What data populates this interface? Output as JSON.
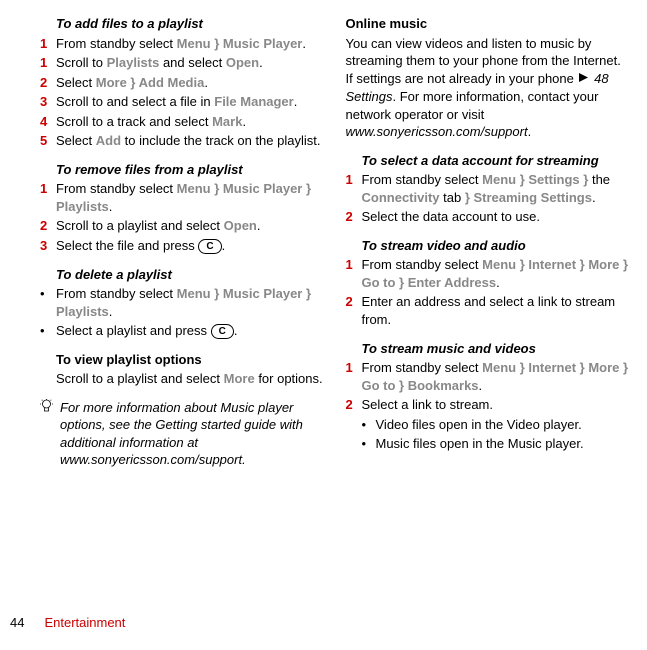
{
  "left": {
    "h1": "To add files to a playlist",
    "s1a": "From standby select ",
    "s1b": "Menu } Music Player",
    "s1c": ".",
    "s2a": "Scroll to ",
    "s2b": "Playlists",
    "s2c": " and select ",
    "s2d": "Open",
    "s2e": ".",
    "s3a": "Select ",
    "s3b": "More } Add Media",
    "s3c": ".",
    "s4a": "Scroll to and select a file in ",
    "s4b": "File Manager",
    "s4c": ".",
    "s5a": "Scroll to a track and select ",
    "s5b": "Mark",
    "s5c": ".",
    "s6a": "Select ",
    "s6b": "Add",
    "s6c": " to include the track on the playlist.",
    "h2": "To remove files from a playlist",
    "r1a": "From standby select ",
    "r1b": "Menu } Music Player } Playlists",
    "r1c": ".",
    "r2a": "Scroll to a playlist and select ",
    "r2b": "Open",
    "r2c": ".",
    "r3a": "Select the file and press ",
    "r3c": ".",
    "h3": "To delete a playlist",
    "d1a": "From standby select ",
    "d1b": "Menu } Music Player } Playlists",
    "d1c": ".",
    "d2a": "Select a playlist and press ",
    "d2c": ".",
    "h4": "To view playlist options",
    "v1a": "Scroll to a playlist and select ",
    "v1b": "More",
    "v1c": " for options.",
    "tip": "For more information about Music player options, see the Getting started guide with additional information at www.sonyericsson.com/support."
  },
  "right": {
    "h1": "Online music",
    "p1a": "You can view videos and listen to music by streaming them to your phone from the Internet. If settings are not already in your phone ",
    "p1b": " 48 Settings",
    "p1c": ". For more information, contact your network operator or visit ",
    "p1d": "www.sonyericsson.com/support",
    "p1e": ".",
    "h2": "To select a data account for streaming",
    "a1a": "From standby select ",
    "a1b": "Menu } Settings }",
    "a1c": " the ",
    "a1d": "Connectivity",
    "a1e": " tab ",
    "a1f": "} Streaming Settings",
    "a1g": ".",
    "a2": "Select the data account to use.",
    "h3": "To stream video and audio",
    "b1a": "From standby select ",
    "b1b": "Menu } Internet } More } Go to } Enter Address",
    "b1c": ".",
    "b2": "Enter an address and select a link to stream from.",
    "h4": "To stream music and videos",
    "c1a": "From standby select ",
    "c1b": "Menu } Internet } More } Go to } Bookmarks",
    "c1c": ".",
    "c2": "Select a link to stream.",
    "sb1": "Video files open in the Video player.",
    "sb2": "Music files open in the Music player."
  },
  "footer": {
    "page": "44",
    "section": "Entertainment"
  },
  "keys": {
    "c": "C"
  }
}
